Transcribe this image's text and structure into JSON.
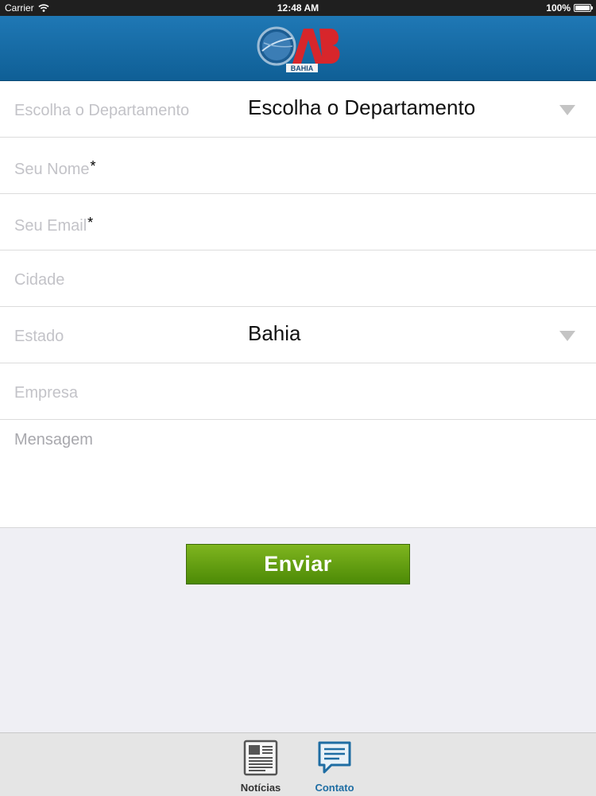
{
  "status_bar": {
    "carrier": "Carrier",
    "time": "12:48 AM",
    "battery": "100%"
  },
  "header": {
    "logo_text": "OAB",
    "logo_subtitle": "BAHIA",
    "brand_color": "#1a6fa8"
  },
  "form": {
    "department": {
      "label": "Escolha o Departamento",
      "value": "Escolha o Departamento"
    },
    "name": {
      "label": "Seu Nome",
      "required_mark": "*"
    },
    "email": {
      "label": "Seu Email",
      "required_mark": "*"
    },
    "city": {
      "label": "Cidade"
    },
    "state": {
      "label": "Estado",
      "value": "Bahia"
    },
    "company": {
      "label": "Empresa"
    },
    "message": {
      "label": "Mensagem"
    }
  },
  "submit": {
    "label": "Enviar",
    "color": "#5f9e0f"
  },
  "tabbar": {
    "items": [
      {
        "label": "Notícias",
        "icon": "newspaper-icon",
        "active": false
      },
      {
        "label": "Contato",
        "icon": "chat-bubble-icon",
        "active": true
      }
    ],
    "active_color": "#1e6da3"
  }
}
